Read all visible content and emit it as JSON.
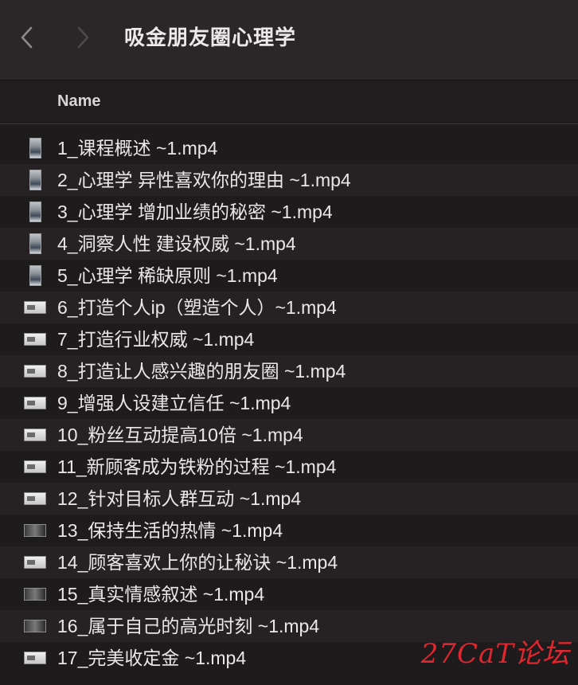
{
  "window": {
    "title": "吸金朋友圈心理学"
  },
  "navigation": {
    "back_icon": "chevron-left-icon",
    "forward_icon": "chevron-right-icon"
  },
  "columns": {
    "name": "Name"
  },
  "files": [
    {
      "name": "1_课程概述 ~1.mp4",
      "thumb": "portrait"
    },
    {
      "name": "2_心理学 异性喜欢你的理由 ~1.mp4",
      "thumb": "portrait"
    },
    {
      "name": "3_心理学 增加业绩的秘密 ~1.mp4",
      "thumb": "portrait"
    },
    {
      "name": "4_洞察人性 建设权威 ~1.mp4",
      "thumb": "portrait"
    },
    {
      "name": "5_心理学 稀缺原则 ~1.mp4",
      "thumb": "portrait"
    },
    {
      "name": "6_打造个人ip（塑造个人）~1.mp4",
      "thumb": "wide"
    },
    {
      "name": "7_打造行业权威 ~1.mp4",
      "thumb": "wide"
    },
    {
      "name": "8_打造让人感兴趣的朋友圈 ~1.mp4",
      "thumb": "wide"
    },
    {
      "name": "9_增强人设建立信任 ~1.mp4",
      "thumb": "wide"
    },
    {
      "name": "10_粉丝互动提高10倍 ~1.mp4",
      "thumb": "wide"
    },
    {
      "name": "11_新顾客成为铁粉的过程 ~1.mp4",
      "thumb": "wide"
    },
    {
      "name": "12_针对目标人群互动 ~1.mp4",
      "thumb": "wide"
    },
    {
      "name": "13_保持生活的热情 ~1.mp4",
      "thumb": "dark"
    },
    {
      "name": "14_顾客喜欢上你的让秘诀 ~1.mp4",
      "thumb": "wide"
    },
    {
      "name": "15_真实情感叙述 ~1.mp4",
      "thumb": "dark"
    },
    {
      "name": "16_属于自己的高光时刻 ~1.mp4",
      "thumb": "dark"
    },
    {
      "name": "17_完美收定金 ~1.mp4",
      "thumb": "wide"
    }
  ],
  "watermark": "27CaT论坛",
  "colors": {
    "background": "#1e1b1c",
    "toolbar": "#2b2728",
    "row_alt": "#262223",
    "text": "#ebe7e8",
    "watermark": "#e0262f"
  }
}
